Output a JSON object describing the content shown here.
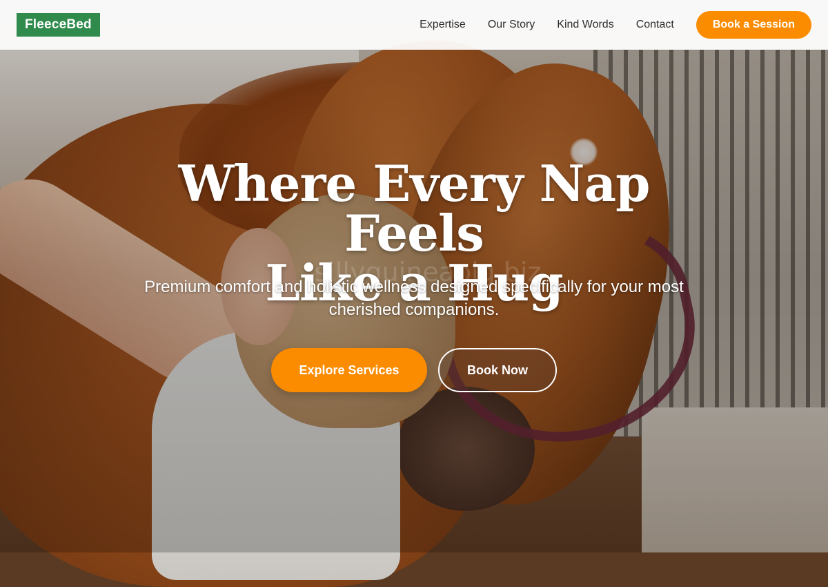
{
  "brand": {
    "logo_text": "FleeceBed",
    "accent_color": "#2f8a4c",
    "cta_color": "#fb8c00"
  },
  "nav": {
    "links": [
      "Expertise",
      "Our Story",
      "Kind Words",
      "Contact"
    ],
    "cta_label": "Book a Session"
  },
  "hero": {
    "title_line1": "Where Every Nap Feels",
    "title_line2": "Like a Hug",
    "subtitle": "Premium comfort and holistic wellness designed specifically for your most cherished companions.",
    "primary_button": "Explore Services",
    "secondary_button": "Book Now",
    "watermark": "sillyguineapig.biz",
    "background_image": "horse-and-woman-in-stable-photo"
  }
}
